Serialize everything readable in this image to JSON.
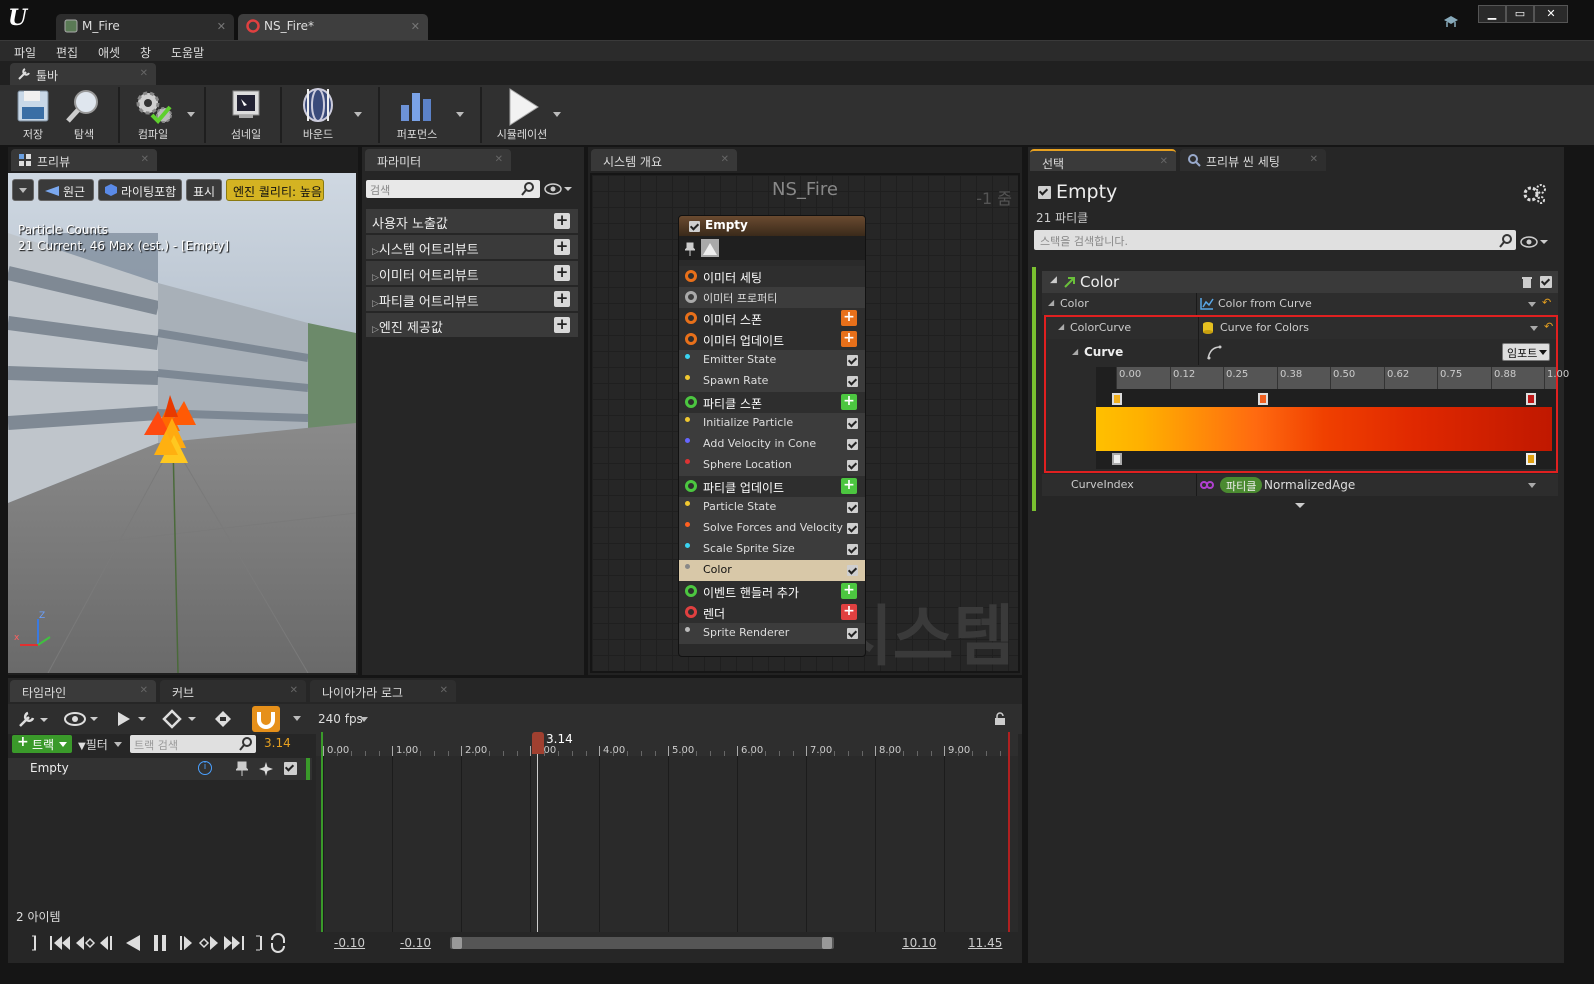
{
  "app": {
    "logo": "U"
  },
  "tabs": [
    {
      "label": "M_Fire",
      "icon": "material-icon"
    },
    {
      "label": "NS_Fire*",
      "icon": "niagara-system-icon"
    }
  ],
  "window_controls": {
    "minimize": "▁",
    "maximize": "▭",
    "close": "✕"
  },
  "menu": [
    "파일",
    "편집",
    "애셋",
    "창",
    "도움말"
  ],
  "toolbar_tab": {
    "label": "툴바"
  },
  "toolbar": {
    "save": "저장",
    "browse": "탐색",
    "compile": "컴파일",
    "thumbnail": "섬네일",
    "bounds": "바운드",
    "performance": "퍼포먼스",
    "simulation": "시뮬레이션"
  },
  "preview": {
    "tab": "프리뷰",
    "view_mode": "원근",
    "lighting": "라이팅포함",
    "show": "표시",
    "quality": "엔진 퀄리티: 높음",
    "stats_title": "Particle Counts",
    "stats_line": "21 Current, 46 Max (est.) - [Empty]",
    "axis_z": "Z",
    "axis_x": "x"
  },
  "params": {
    "tab": "파라미터",
    "search_placeholder": "검색",
    "sections": [
      "사용자 노출값",
      "시스템 어트리뷰트",
      "이미터 어트리뷰트",
      "파티클 어트리뷰트",
      "엔진 제공값"
    ]
  },
  "overview": {
    "tab": "시스템 개요",
    "title": "NS_Fire",
    "zoom": "-1 줌",
    "watermark": "시스템",
    "node_title": "Empty",
    "rows": [
      {
        "label": "이미터 세팅",
        "kind": "head",
        "icon": "#e8701a"
      },
      {
        "label": "이미터 프로퍼티",
        "kind": "sub",
        "icon": "#aaa"
      },
      {
        "label": "이미터 스폰",
        "kind": "head",
        "icon": "#e8701a",
        "plus": "#e8701a"
      },
      {
        "label": "이미터 업데이트",
        "kind": "head",
        "icon": "#e8701a",
        "plus": "#e8701a"
      },
      {
        "label": "Emitter State",
        "kind": "sub",
        "dot": "#3ad3f0",
        "check": true
      },
      {
        "label": "Spawn Rate",
        "kind": "sub",
        "dot": "#f0c830",
        "check": true
      },
      {
        "label": "파티클 스폰",
        "kind": "head",
        "icon": "#4cc640",
        "plus": "#4cc640"
      },
      {
        "label": "Initialize Particle",
        "kind": "sub",
        "dot": "#f0c830",
        "check": true
      },
      {
        "label": "Add Velocity in Cone",
        "kind": "sub",
        "dot": "#6666ff",
        "check": true
      },
      {
        "label": "Sphere Location",
        "kind": "sub",
        "dot": "#dd3333",
        "check": true
      },
      {
        "label": "파티클 업데이트",
        "kind": "head",
        "icon": "#4cc640",
        "plus": "#4cc640"
      },
      {
        "label": "Particle State",
        "kind": "sub",
        "dot": "#f0c830",
        "check": true
      },
      {
        "label": "Solve Forces and Velocity",
        "kind": "sub",
        "dot": "#ff6020",
        "check": true
      },
      {
        "label": "Scale Sprite Size",
        "kind": "sub",
        "dot": "#3ad3f0",
        "check": true
      },
      {
        "label": "Color",
        "kind": "selected",
        "dot": "#888",
        "check": true
      },
      {
        "label": "이벤트 핸들러 추가",
        "kind": "head",
        "icon": "#4cc640",
        "plus": "#4cc640"
      },
      {
        "label": "렌더",
        "kind": "head",
        "icon": "#e04040",
        "plus": "#e04040"
      },
      {
        "label": "Sprite Renderer",
        "kind": "sub",
        "dot": "#bbb",
        "check": true
      }
    ]
  },
  "details": {
    "tabs": [
      "선택",
      "프리뷰 씬 세팅"
    ],
    "title": "Empty",
    "subtitle": "21 파티클",
    "search_placeholder": "스택을 검색합니다.",
    "module": "Color",
    "color_label": "Color",
    "color_value": "Color from Curve",
    "curve_label": "ColorCurve",
    "curve_value": "Curve for Colors",
    "curve_sub": "Curve",
    "import": "임포트",
    "ruler": [
      "0.00",
      "0.12",
      "0.25",
      "0.38",
      "0.50",
      "0.62",
      "0.75",
      "0.88",
      "1.00"
    ],
    "index_label": "CurveIndex",
    "index_badge": "파티클",
    "index_value": "NormalizedAge"
  },
  "timeline": {
    "tabs": [
      "타임라인",
      "커브",
      "나이아가라 로그"
    ],
    "fps": "240 fps",
    "track_btn": "트랙",
    "filter_btn": "필터",
    "search_placeholder": "트랙 검색",
    "time_value": "3.14",
    "track_name": "Empty",
    "items_count": "2 아이템",
    "playhead": "3.14",
    "ticks": [
      "0.00",
      "1.00",
      "2.00",
      "3.00",
      "4.00",
      "5.00",
      "6.00",
      "7.00",
      "8.00",
      "9.00"
    ],
    "range_start_a": "-0.10",
    "range_start_b": "-0.10",
    "range_end_a": "10.10",
    "range_end_b": "11.45"
  }
}
